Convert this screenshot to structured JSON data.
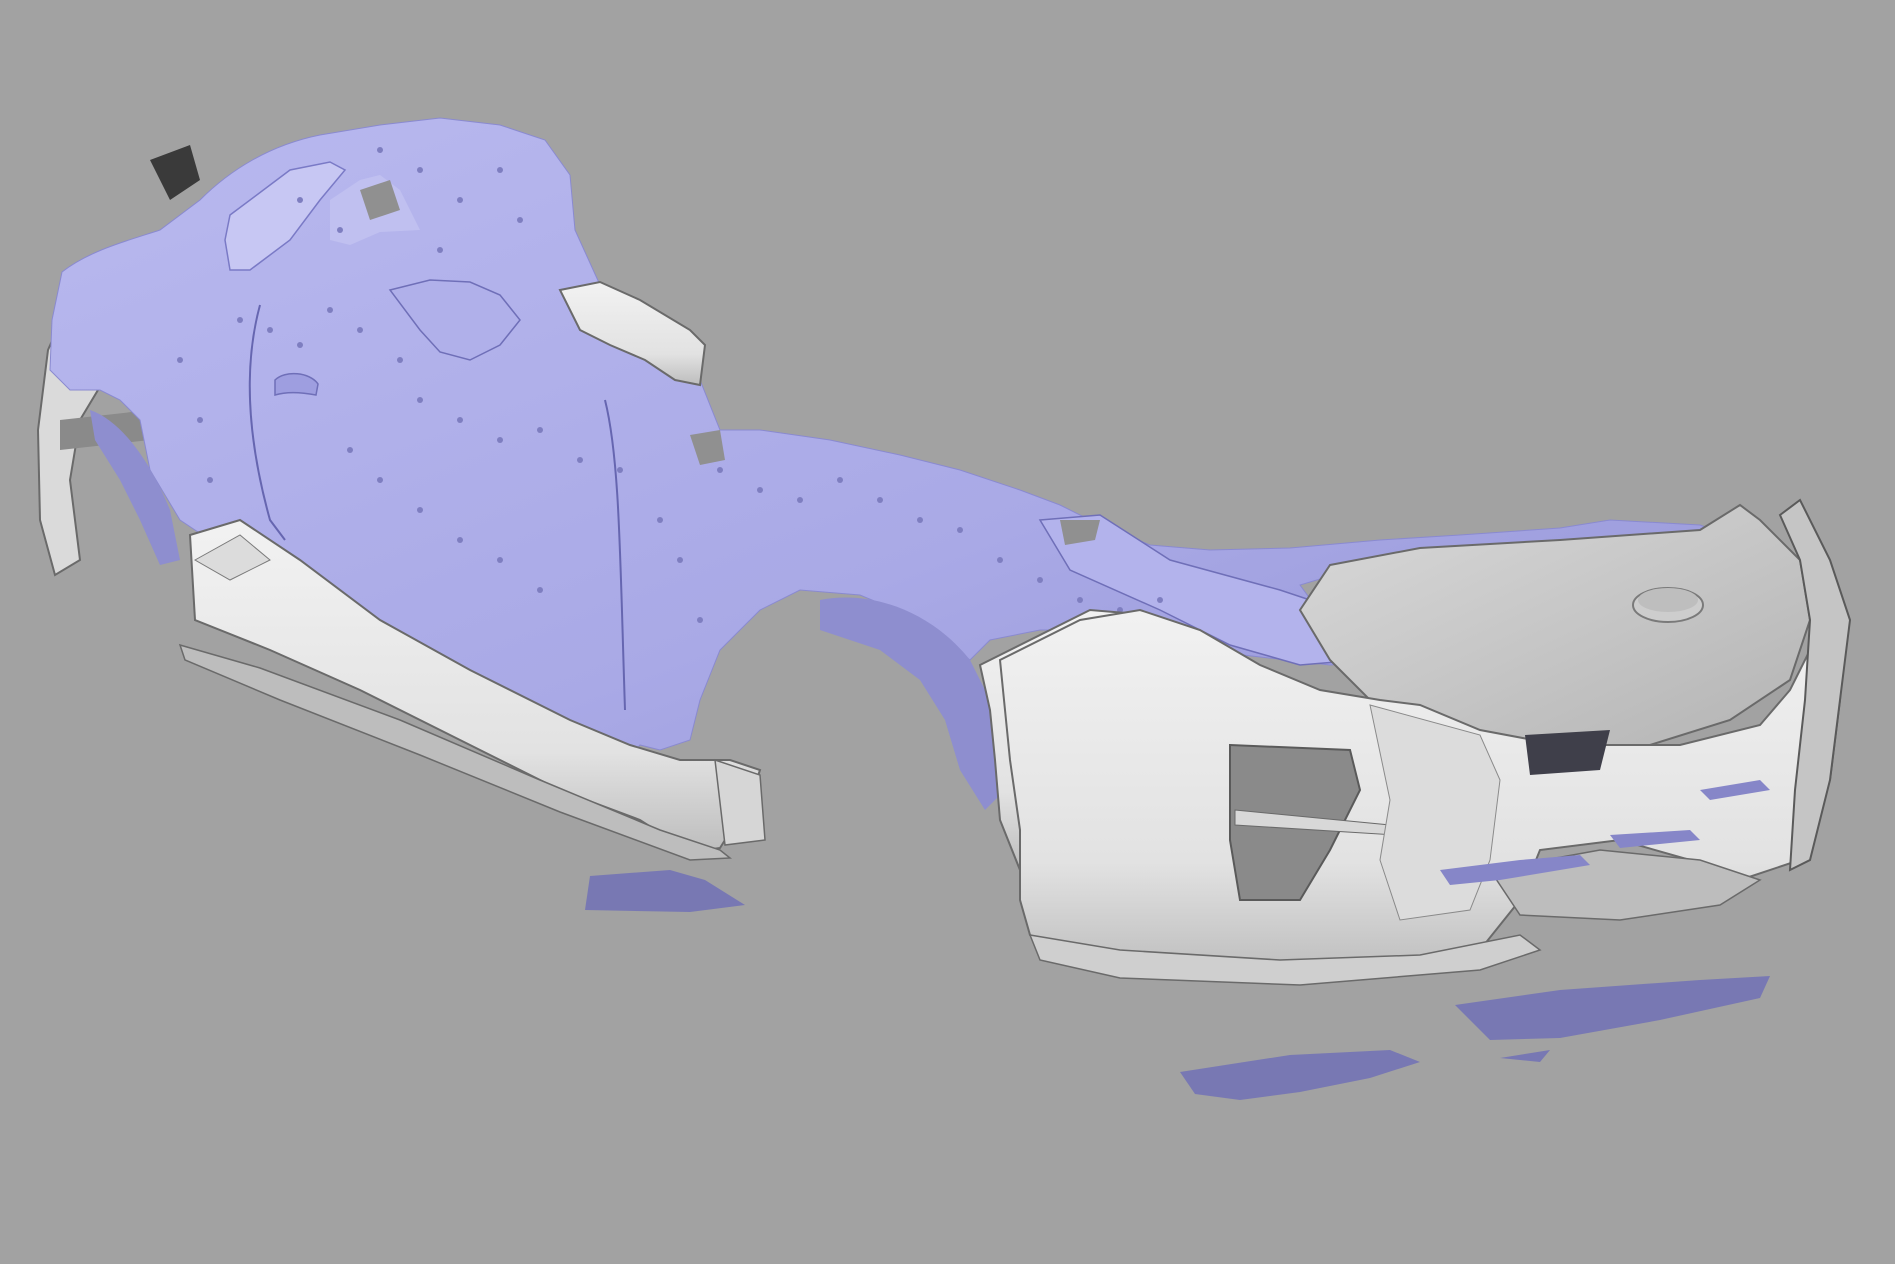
{
  "viewport": {
    "background": "#a2a2a2",
    "content": "3d-render-car-bodykit-with-scan-overlay"
  },
  "colors": {
    "scan_mesh": "#adadea",
    "scan_mesh_shadow": "#7c7cc0",
    "scan_mesh_dark": "#6d6da8",
    "cad_part": "#e9e9e9",
    "cad_part_shade": "#c4c4c4",
    "cad_part_dark": "#8f8f8f",
    "edge": "#5c5c5c"
  }
}
